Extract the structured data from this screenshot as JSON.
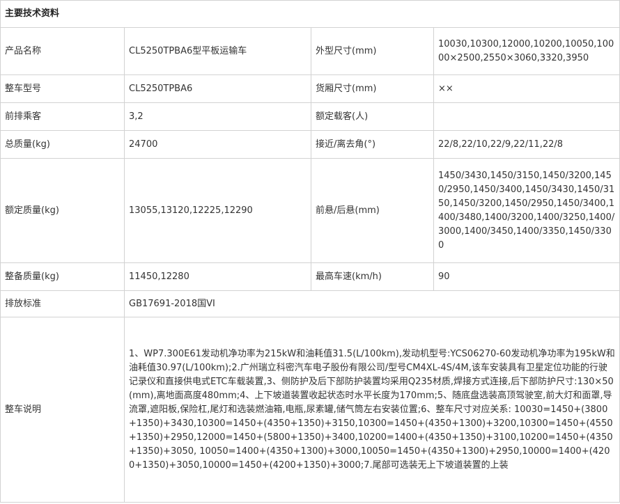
{
  "section_title": "主要技术资料",
  "rows": {
    "product_name": {
      "label": "产品名称",
      "value": "CL5250TPBA6型平板运输车"
    },
    "dimensions": {
      "label": "外型尺寸(mm)",
      "value": "10030,10300,12000,10200,10050,10000×2500,2550×3060,3320,3950"
    },
    "model": {
      "label": "整车型号",
      "value": "CL5250TPBA6"
    },
    "cargo_dimensions": {
      "label": "货厢尺寸(mm)",
      "value": "××"
    },
    "front_passengers": {
      "label": "前排乘客",
      "value": "3,2"
    },
    "rated_passengers": {
      "label": "额定载客(人)",
      "value": ""
    },
    "total_mass": {
      "label": "总质量(kg)",
      "value": "24700"
    },
    "approach_departure": {
      "label": "接近/离去角(°)",
      "value": "22/8,22/10,22/9,22/11,22/8"
    },
    "rated_mass": {
      "label": "额定质量(kg)",
      "value": "13055,13120,12225,12290"
    },
    "overhang": {
      "label": "前悬/后悬(mm)",
      "value": "1450/3430,1450/3150,1450/3200,1450/2950,1450/3400,1450/3430,1450/3150,1450/3200,1450/2950,1450/3400,1400/3480,1400/3200,1400/3250,1400/3000,1400/3450,1400/3350,1450/3300"
    },
    "curb_mass": {
      "label": "整备质量(kg)",
      "value": "11450,12280"
    },
    "max_speed": {
      "label": "最高车速(km/h)",
      "value": "90"
    },
    "emission": {
      "label": "排放标准",
      "value": "GB17691-2018国VI"
    },
    "description": {
      "label": "整车说明",
      "value": "1、WP7.300E61发动机净功率为215kW和油耗值31.5(L/100km),发动机型号:YCS06270-60发动机净功率为195kW和油耗值30.97(L/100km);2.广州瑞立科密汽车电子股份有限公司/型号CM4XL-4S/4M,该车安装具有卫星定位功能的行驶记录仪和直接供电式ETC车载装置,3、侧防护及后下部防护装置均采用Q235材质,焊接方式连接,后下部防护尺寸:130×50(mm),离地面高度480mm;4、上下坡道装置收起状态时水平长度为170mm;5、随底盘选装高顶驾驶室,前大灯和面罩,导流罩,遮阳板,保险杠,尾灯和选装燃油箱,电瓶,尿素罐,储气筒左右安装位置;6、整车尺寸对应关系: 10030=1450+(3800+1350)+3430,10300=1450+(4350+1350)+3150,10300=1450+(4350+1300)+3200,10300=1450+(4550+1350)+2950,12000=1450+(5800+1350)+3400,10200=1400+(4350+1350)+3100,10200=1450+(4350+1350)+3050, 10050=1400+(4350+1300)+3000,10050=1450+(4350+1300)+2950,10000=1400+(4200+1350)+3050,10000=1450+(4200+1350)+3000;7.尾部可选装无上下坡道装置的上装"
    }
  }
}
